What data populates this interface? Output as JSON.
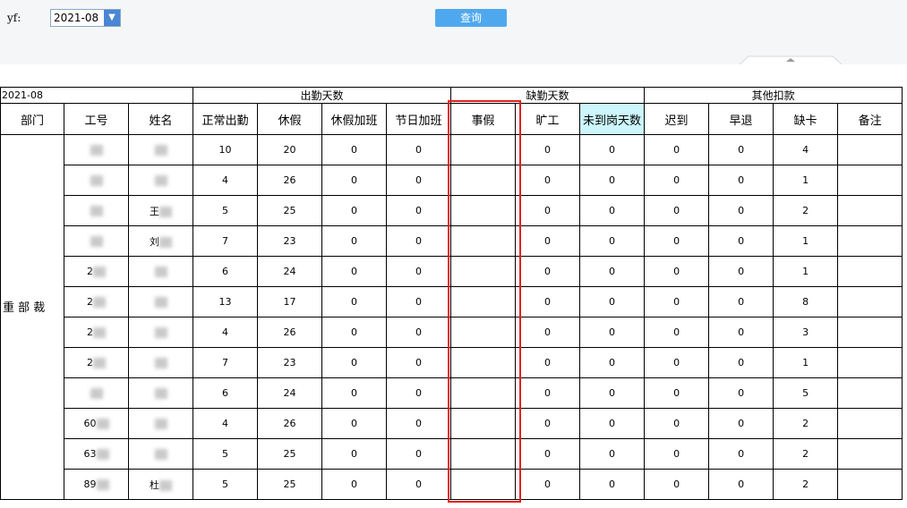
{
  "filter": {
    "label": "yf:",
    "month_value": "2021-08",
    "query_button": "查询"
  },
  "table": {
    "month": "2021-08",
    "groups": {
      "attendance": "出勤天数",
      "absence": "缺勤天数",
      "deductions": "其他扣款"
    },
    "columns": [
      "部门",
      "工号",
      "姓名",
      "正常出勤",
      "休假",
      "休假加班",
      "节日加班",
      "事假",
      "旷工",
      "未到岗天数",
      "迟到",
      "早退",
      "缺卡",
      "备注"
    ],
    "department": "重 部 裁",
    "rows": [
      {
        "id": "",
        "name": "",
        "normal": "10",
        "leave": "20",
        "leave_ot": "0",
        "holiday_ot": "0",
        "personal": "",
        "absent": "0",
        "not_arrived": "0",
        "late": "0",
        "early": "0",
        "missing": "4"
      },
      {
        "id": "",
        "name": "",
        "normal": "4",
        "leave": "26",
        "leave_ot": "0",
        "holiday_ot": "0",
        "personal": "",
        "absent": "0",
        "not_arrived": "0",
        "late": "0",
        "early": "0",
        "missing": "1"
      },
      {
        "id": "",
        "name": "王",
        "normal": "5",
        "leave": "25",
        "leave_ot": "0",
        "holiday_ot": "0",
        "personal": "",
        "absent": "0",
        "not_arrived": "0",
        "late": "0",
        "early": "0",
        "missing": "2"
      },
      {
        "id": "",
        "name": "刘",
        "normal": "7",
        "leave": "23",
        "leave_ot": "0",
        "holiday_ot": "0",
        "personal": "",
        "absent": "0",
        "not_arrived": "0",
        "late": "0",
        "early": "0",
        "missing": "1"
      },
      {
        "id": "2",
        "name": "",
        "normal": "6",
        "leave": "24",
        "leave_ot": "0",
        "holiday_ot": "0",
        "personal": "",
        "absent": "0",
        "not_arrived": "0",
        "late": "0",
        "early": "0",
        "missing": "1"
      },
      {
        "id": "2",
        "name": "",
        "normal": "13",
        "leave": "17",
        "leave_ot": "0",
        "holiday_ot": "0",
        "personal": "",
        "absent": "0",
        "not_arrived": "0",
        "late": "0",
        "early": "0",
        "missing": "8"
      },
      {
        "id": "2",
        "name": "",
        "normal": "4",
        "leave": "26",
        "leave_ot": "0",
        "holiday_ot": "0",
        "personal": "",
        "absent": "0",
        "not_arrived": "0",
        "late": "0",
        "early": "0",
        "missing": "3"
      },
      {
        "id": "2",
        "name": "",
        "normal": "7",
        "leave": "23",
        "leave_ot": "0",
        "holiday_ot": "0",
        "personal": "",
        "absent": "0",
        "not_arrived": "0",
        "late": "0",
        "early": "0",
        "missing": "1"
      },
      {
        "id": "",
        "name": "",
        "normal": "6",
        "leave": "24",
        "leave_ot": "0",
        "holiday_ot": "0",
        "personal": "",
        "absent": "0",
        "not_arrived": "0",
        "late": "0",
        "early": "0",
        "missing": "5"
      },
      {
        "id": "60",
        "name": "",
        "normal": "4",
        "leave": "26",
        "leave_ot": "0",
        "holiday_ot": "0",
        "personal": "",
        "absent": "0",
        "not_arrived": "0",
        "late": "0",
        "early": "0",
        "missing": "2"
      },
      {
        "id": "63",
        "name": "",
        "normal": "5",
        "leave": "25",
        "leave_ot": "0",
        "holiday_ot": "0",
        "personal": "",
        "absent": "0",
        "not_arrived": "0",
        "late": "0",
        "early": "0",
        "missing": "2"
      },
      {
        "id": "89",
        "name": "杜",
        "normal": "5",
        "leave": "25",
        "leave_ot": "0",
        "holiday_ot": "0",
        "personal": "",
        "absent": "0",
        "not_arrived": "0",
        "late": "0",
        "early": "0",
        "missing": "2"
      }
    ]
  },
  "colors": {
    "highlight_box": "#e41f1f",
    "header_highlight": "#ccf6fb",
    "query_button": "#4fa8ee"
  }
}
